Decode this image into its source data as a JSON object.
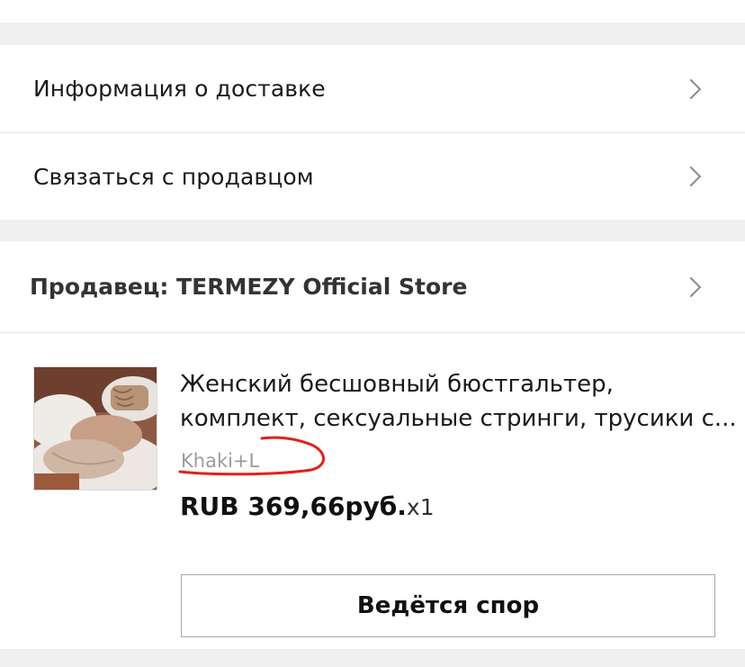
{
  "delivery_info": {
    "label": "Информация о доставке",
    "icon": "chevron-right-icon"
  },
  "contact_seller": {
    "label": "Связаться с продавцом",
    "icon": "chevron-right-icon"
  },
  "seller": {
    "text": "Продавец: TERMEZY Official Store",
    "icon": "chevron-right-icon"
  },
  "order_item": {
    "title_line1": "Женский бесшовный бюстгальтер,",
    "title_line2": "комплект, сексуальные стринги, трусики с...",
    "variant": "Khaki+L",
    "price": "RUB 369,66руб.",
    "quantity": "x1",
    "annotation_color": "#e0211a"
  },
  "dispute_button": {
    "label": "Ведётся спор"
  },
  "colors": {
    "background": "#f0f0f0",
    "panel": "#ffffff",
    "border": "#a8a8a8"
  }
}
